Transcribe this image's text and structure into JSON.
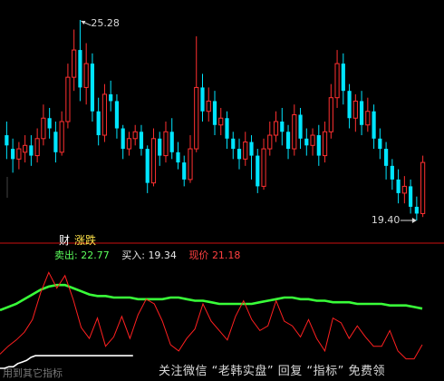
{
  "chart_data": [
    {
      "type": "candlestick",
      "high_label": "25.28",
      "low_label": "19.40",
      "badges": [
        "财",
        "涨跌"
      ],
      "bull_color": "#ff3030",
      "bear_color": "#00e5ff",
      "ylim": [
        19.0,
        25.6
      ],
      "candles": [
        {
          "o": 21.9,
          "c": 21.6,
          "h": 22.3,
          "l": 21.2
        },
        {
          "o": 21.5,
          "c": 21.2,
          "h": 21.8,
          "l": 20.8
        },
        {
          "o": 21.2,
          "c": 21.5,
          "h": 21.7,
          "l": 20.9
        },
        {
          "o": 21.4,
          "c": 21.6,
          "h": 21.9,
          "l": 21.1
        },
        {
          "o": 21.6,
          "c": 21.3,
          "h": 21.9,
          "l": 21.0
        },
        {
          "o": 21.3,
          "c": 21.8,
          "h": 22.1,
          "l": 21.1
        },
        {
          "o": 21.8,
          "c": 22.4,
          "h": 22.8,
          "l": 21.6
        },
        {
          "o": 22.4,
          "c": 22.1,
          "h": 22.7,
          "l": 21.8
        },
        {
          "o": 22.0,
          "c": 21.4,
          "h": 22.3,
          "l": 21.1
        },
        {
          "o": 21.4,
          "c": 22.3,
          "h": 22.6,
          "l": 21.3
        },
        {
          "o": 22.3,
          "c": 23.6,
          "h": 24.0,
          "l": 22.1
        },
        {
          "o": 23.6,
          "c": 24.4,
          "h": 25.0,
          "l": 23.2
        },
        {
          "o": 24.4,
          "c": 23.3,
          "h": 25.28,
          "l": 22.9
        },
        {
          "o": 23.3,
          "c": 24.0,
          "h": 24.6,
          "l": 22.8
        },
        {
          "o": 24.0,
          "c": 22.6,
          "h": 24.3,
          "l": 22.3
        },
        {
          "o": 22.6,
          "c": 21.9,
          "h": 23.0,
          "l": 21.6
        },
        {
          "o": 21.9,
          "c": 23.1,
          "h": 23.4,
          "l": 21.7
        },
        {
          "o": 23.1,
          "c": 22.9,
          "h": 23.5,
          "l": 22.6
        },
        {
          "o": 22.9,
          "c": 22.1,
          "h": 23.1,
          "l": 21.8
        },
        {
          "o": 22.1,
          "c": 21.5,
          "h": 22.2,
          "l": 21.2
        },
        {
          "o": 21.5,
          "c": 21.8,
          "h": 22.0,
          "l": 21.3
        },
        {
          "o": 21.8,
          "c": 22.0,
          "h": 22.2,
          "l": 21.6
        },
        {
          "o": 22.0,
          "c": 21.5,
          "h": 22.2,
          "l": 21.3
        },
        {
          "o": 21.5,
          "c": 20.5,
          "h": 21.6,
          "l": 20.2
        },
        {
          "o": 20.5,
          "c": 21.8,
          "h": 22.1,
          "l": 20.4
        },
        {
          "o": 21.8,
          "c": 21.3,
          "h": 22.0,
          "l": 21.0
        },
        {
          "o": 21.3,
          "c": 22.0,
          "h": 22.3,
          "l": 21.1
        },
        {
          "o": 22.0,
          "c": 21.4,
          "h": 22.4,
          "l": 21.2
        },
        {
          "o": 21.4,
          "c": 21.1,
          "h": 21.7,
          "l": 20.9
        },
        {
          "o": 21.1,
          "c": 20.6,
          "h": 21.3,
          "l": 20.4
        },
        {
          "o": 20.6,
          "c": 21.5,
          "h": 21.9,
          "l": 20.5
        },
        {
          "o": 21.5,
          "c": 23.3,
          "h": 24.8,
          "l": 21.4
        },
        {
          "o": 23.3,
          "c": 22.6,
          "h": 23.7,
          "l": 22.3
        },
        {
          "o": 22.6,
          "c": 22.9,
          "h": 23.3,
          "l": 22.3
        },
        {
          "o": 22.9,
          "c": 22.2,
          "h": 23.2,
          "l": 21.9
        },
        {
          "o": 22.2,
          "c": 22.4,
          "h": 22.7,
          "l": 21.9
        },
        {
          "o": 22.4,
          "c": 21.8,
          "h": 22.6,
          "l": 21.5
        },
        {
          "o": 21.8,
          "c": 21.5,
          "h": 22.0,
          "l": 21.2
        },
        {
          "o": 21.5,
          "c": 21.2,
          "h": 21.8,
          "l": 20.9
        },
        {
          "o": 21.2,
          "c": 21.7,
          "h": 22.0,
          "l": 21.0
        },
        {
          "o": 21.7,
          "c": 21.3,
          "h": 21.9,
          "l": 20.6
        },
        {
          "o": 21.3,
          "c": 20.4,
          "h": 21.5,
          "l": 20.2
        },
        {
          "o": 20.4,
          "c": 21.5,
          "h": 21.8,
          "l": 20.3
        },
        {
          "o": 21.5,
          "c": 21.9,
          "h": 22.3,
          "l": 21.3
        },
        {
          "o": 21.9,
          "c": 22.3,
          "h": 22.6,
          "l": 21.7
        },
        {
          "o": 22.3,
          "c": 22.0,
          "h": 22.7,
          "l": 21.6
        },
        {
          "o": 22.0,
          "c": 21.5,
          "h": 22.2,
          "l": 21.2
        },
        {
          "o": 21.5,
          "c": 22.5,
          "h": 22.8,
          "l": 21.3
        },
        {
          "o": 22.5,
          "c": 21.8,
          "h": 22.7,
          "l": 21.5
        },
        {
          "o": 21.8,
          "c": 21.6,
          "h": 22.1,
          "l": 21.3
        },
        {
          "o": 21.6,
          "c": 21.9,
          "h": 22.1,
          "l": 21.3
        },
        {
          "o": 21.9,
          "c": 21.3,
          "h": 22.2,
          "l": 21.0
        },
        {
          "o": 21.3,
          "c": 22.0,
          "h": 22.3,
          "l": 21.1
        },
        {
          "o": 22.0,
          "c": 23.0,
          "h": 23.4,
          "l": 21.8
        },
        {
          "o": 23.0,
          "c": 24.0,
          "h": 24.4,
          "l": 22.7
        },
        {
          "o": 24.0,
          "c": 23.2,
          "h": 24.3,
          "l": 22.8
        },
        {
          "o": 23.2,
          "c": 22.4,
          "h": 23.4,
          "l": 22.1
        },
        {
          "o": 22.4,
          "c": 22.9,
          "h": 23.1,
          "l": 22.0
        },
        {
          "o": 22.9,
          "c": 22.2,
          "h": 23.2,
          "l": 21.9
        },
        {
          "o": 22.2,
          "c": 22.6,
          "h": 23.0,
          "l": 22.0
        },
        {
          "o": 22.6,
          "c": 21.8,
          "h": 22.8,
          "l": 21.5
        },
        {
          "o": 21.8,
          "c": 21.5,
          "h": 22.1,
          "l": 21.2
        },
        {
          "o": 21.5,
          "c": 21.0,
          "h": 21.7,
          "l": 20.6
        },
        {
          "o": 21.0,
          "c": 20.6,
          "h": 21.2,
          "l": 20.3
        },
        {
          "o": 20.6,
          "c": 20.2,
          "h": 20.9,
          "l": 19.9
        },
        {
          "o": 20.2,
          "c": 20.4,
          "h": 20.7,
          "l": 19.9
        },
        {
          "o": 20.4,
          "c": 19.8,
          "h": 20.6,
          "l": 19.6
        },
        {
          "o": 19.8,
          "c": 19.6,
          "h": 20.1,
          "l": 19.4
        },
        {
          "o": 19.6,
          "c": 21.1,
          "h": 21.3,
          "l": 19.5
        }
      ]
    },
    {
      "type": "line",
      "labels": {
        "sell_label": "卖出:",
        "sell_value": "22.77",
        "buy_label": "买入:",
        "buy_value": "19.34",
        "price_label": "现价",
        "price_value": "21.18"
      },
      "ylim": [
        18.5,
        25.6
      ],
      "series": [
        {
          "color": "#39ff39",
          "values": [
            22.2,
            22.4,
            22.6,
            22.9,
            23.2,
            23.5,
            23.7,
            23.8,
            23.8,
            23.6,
            23.4,
            23.2,
            23.1,
            23.1,
            23.0,
            23.0,
            23.0,
            22.9,
            22.9,
            22.9,
            22.9,
            23.0,
            23.0,
            22.9,
            22.8,
            22.8,
            22.7,
            22.6,
            22.6,
            22.6,
            22.6,
            22.6,
            22.7,
            22.8,
            22.9,
            23.0,
            23.0,
            22.9,
            22.9,
            22.8,
            22.8,
            22.7,
            22.7,
            22.7,
            22.6,
            22.6,
            22.6,
            22.6,
            22.5,
            22.5,
            22.5,
            22.4,
            22.3
          ]
        },
        {
          "color": "#ff2020",
          "values": [
            19.4,
            19.9,
            20.3,
            20.8,
            21.6,
            23.3,
            24.6,
            23.6,
            24.4,
            22.9,
            21.1,
            20.4,
            21.7,
            19.9,
            20.5,
            21.8,
            20.4,
            21.9,
            22.9,
            22.6,
            21.5,
            20.0,
            19.6,
            20.4,
            21.0,
            22.6,
            21.5,
            20.9,
            20.3,
            21.8,
            22.8,
            21.6,
            20.9,
            21.2,
            22.8,
            21.5,
            21.2,
            20.5,
            21.6,
            20.4,
            19.6,
            21.7,
            21.4,
            20.4,
            21.2,
            20.5,
            19.9,
            19.9,
            20.9,
            19.6,
            19.1,
            19.1,
            20.0
          ]
        },
        {
          "color": "#ffffff",
          "values": [
            18.5,
            18.5,
            18.6,
            18.6,
            18.8,
            18.9,
            19.0,
            19.2,
            19.3,
            19.3,
            19.3,
            19.3,
            19.3,
            19.3,
            19.3,
            19.3,
            19.3,
            19.3,
            19.3,
            19.3,
            19.3,
            19.3,
            19.3,
            19.3,
            19.3,
            19.3,
            19.3,
            19.3,
            19.3,
            19.3,
            19.3
          ]
        }
      ]
    }
  ],
  "overlay": {
    "footer_text": "关注微信 “老韩实盘” 回复 “指标” 免费领",
    "watermark_left": "用到其它指标"
  }
}
